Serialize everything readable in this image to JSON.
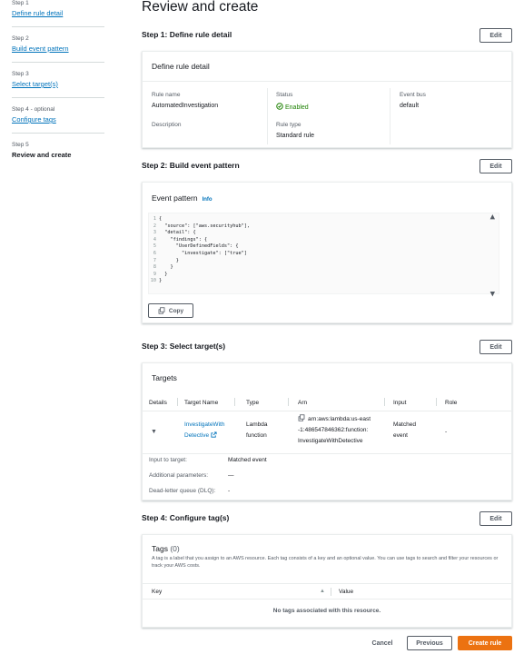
{
  "sidebar": {
    "steps": [
      {
        "num": "Step 1",
        "label": "Define rule detail"
      },
      {
        "num": "Step 2",
        "label": "Build event pattern"
      },
      {
        "num": "Step 3",
        "label": "Select target(s)"
      },
      {
        "num": "Step 4 - optional",
        "label": "Configure tags"
      },
      {
        "num": "Step 5",
        "label": "Review and create"
      }
    ]
  },
  "page_title": "Review and create",
  "edit_label": "Edit",
  "step1": {
    "heading": "Step 1: Define rule detail",
    "panel_title": "Define rule detail",
    "rule_name_label": "Rule name",
    "rule_name_value": "AutomatedInvestigation",
    "description_label": "Description",
    "status_label": "Status",
    "status_value": "Enabled",
    "rule_type_label": "Rule type",
    "rule_type_value": "Standard rule",
    "event_bus_label": "Event bus",
    "event_bus_value": "default"
  },
  "step2": {
    "heading": "Step 2: Build event pattern",
    "panel_title": "Event pattern",
    "info_label": "Info",
    "code_lines": [
      "{",
      "  \"source\": [\"aws.securityhub\"],",
      "  \"detail\": {",
      "    \"findings\": {",
      "      \"UserDefinedFields\": {",
      "        \"investigate\": [\"true\"]",
      "      }",
      "    }",
      "  }",
      "}"
    ],
    "copy_label": "Copy"
  },
  "step3": {
    "heading": "Step 3: Select target(s)",
    "panel_title": "Targets",
    "columns": [
      "Details",
      "Target Name",
      "Type",
      "Arn",
      "Input",
      "Role"
    ],
    "row": {
      "target_name_line1": "InvestigateWith",
      "target_name_line2": "Detective",
      "type_line1": "Lambda",
      "type_line2": "function",
      "arn_line1": "arn:aws:lambda:us-east",
      "arn_line2": "-1:486547846362:function:",
      "arn_line3": "InvestigateWithDetective",
      "input_line1": "Matched",
      "input_line2": "event",
      "role": "-"
    },
    "details": [
      {
        "label": "Input to target:",
        "value": "Matched event"
      },
      {
        "label": "Additional parameters:",
        "value": "—"
      },
      {
        "label": "Dead-letter queue (DLQ):",
        "value": "-"
      }
    ]
  },
  "step4": {
    "heading": "Step 4: Configure tag(s)",
    "panel_title": "Tags",
    "count": "(0)",
    "description": "A tag is a label that you assign to an AWS resource. Each tag consists of a key and an optional value. You can use tags to search and filter your resources or track your AWS costs.",
    "key_col": "Key",
    "value_col": "Value",
    "empty_text": "No tags associated with this resource."
  },
  "footer": {
    "cancel": "Cancel",
    "previous": "Previous",
    "create": "Create rule"
  },
  "colors": {
    "link": "#0073bb",
    "primary": "#ec7211",
    "success": "#1d8102"
  }
}
